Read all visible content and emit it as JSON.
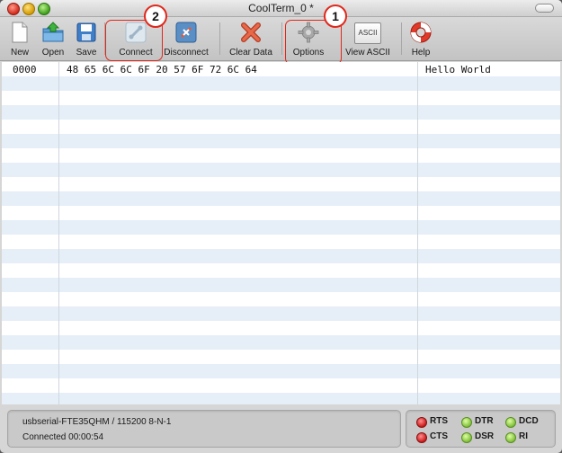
{
  "window": {
    "title": "CoolTerm_0 *"
  },
  "toolbar": {
    "new_label": "New",
    "open_label": "Open",
    "save_label": "Save",
    "connect_label": "Connect",
    "disconnect_label": "Disconnect",
    "clear_data_label": "Clear Data",
    "options_label": "Options",
    "view_ascii_label": "View ASCII",
    "help_label": "Help",
    "ascii_icon_text": "ASCII"
  },
  "annotations": {
    "badge_1": "1",
    "badge_2": "2"
  },
  "data_view": {
    "rows": [
      {
        "offset": "0000",
        "hex": "48 65 6C 6C 6F 20 57 6F 72 6C 64",
        "ascii": "Hello World"
      }
    ]
  },
  "status": {
    "port_line": "usbserial-FTE35QHM / 115200 8-N-1",
    "connection_line": "Connected 00:00:54"
  },
  "signals": {
    "rts": "RTS",
    "dtr": "DTR",
    "dcd": "DCD",
    "cts": "CTS",
    "dsr": "DSR",
    "ri": "RI"
  },
  "colors": {
    "annotation_red": "#e0281c",
    "stripe_blue": "#e6eef8",
    "led_red": "#c91a1a",
    "led_green": "#7fbf3a"
  }
}
